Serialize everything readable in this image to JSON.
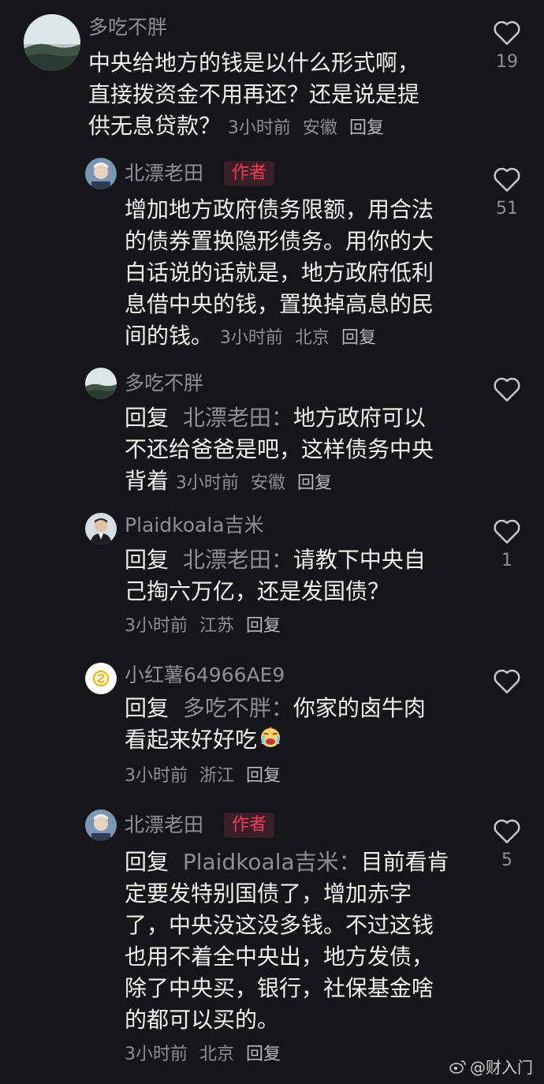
{
  "comments": [
    {
      "user": "多吃不胖",
      "text_lines": [
        "中央给地方的钱是以什么形式啊，",
        "直接拨资金不用再还？还是说是提",
        "供无息贷款？"
      ],
      "time": "3小时前",
      "location": "安徽",
      "reply": "回复",
      "likes": "19"
    },
    {
      "user": "北漂老田",
      "badge": "作者",
      "text_lines": [
        "增加地方政府债务限额，用合法",
        "的债券置换隐形债务。用你的大",
        "白话说的话就是，地方政府低利",
        "息借中央的钱，置换掉高息的民",
        "间的钱。"
      ],
      "time": "3小时前",
      "location": "北京",
      "reply": "回复",
      "likes": "51"
    },
    {
      "user": "多吃不胖",
      "reply_prefix": "回复",
      "reply_target": "北漂老田：",
      "text_lines": [
        "地方政府可以",
        "不还给爸爸是吧，这样债务中央",
        "背着"
      ],
      "time": "3小时前",
      "location": "安徽",
      "reply": "回复",
      "likes": ""
    },
    {
      "user": "Plaidkoala吉米",
      "reply_prefix": "回复",
      "reply_target": "北漂老田：",
      "text_lines": [
        "请教下中央自",
        "己掏六万亿，还是发国债？"
      ],
      "time": "3小时前",
      "location": "江苏",
      "reply": "回复",
      "likes": "1"
    },
    {
      "user": "小红薯64966AE9",
      "reply_prefix": "回复",
      "reply_target": "多吃不胖：",
      "text_lines": [
        "你家的卤牛肉",
        "看起来好好吃"
      ],
      "time": "3小时前",
      "location": "浙江",
      "reply": "回复",
      "likes": ""
    },
    {
      "user": "北漂老田",
      "badge": "作者",
      "reply_prefix": "回复",
      "reply_target": "Plaidkoala吉米：",
      "text_lines": [
        "目前看肯",
        "定要发特别国债了，增加赤字",
        "了，中央没这没多钱。不过这钱",
        "也用不着全中央出，地方发债，",
        "除了中央买，银行，社保基金啥",
        "的都可以买的。"
      ],
      "time": "3小时前",
      "location": "北京",
      "reply": "回复",
      "likes": "5"
    }
  ],
  "watermark": "@财入门",
  "colors": {
    "accent": "#ff3b5c",
    "muted": "#8f8f94",
    "background": "#161619"
  }
}
